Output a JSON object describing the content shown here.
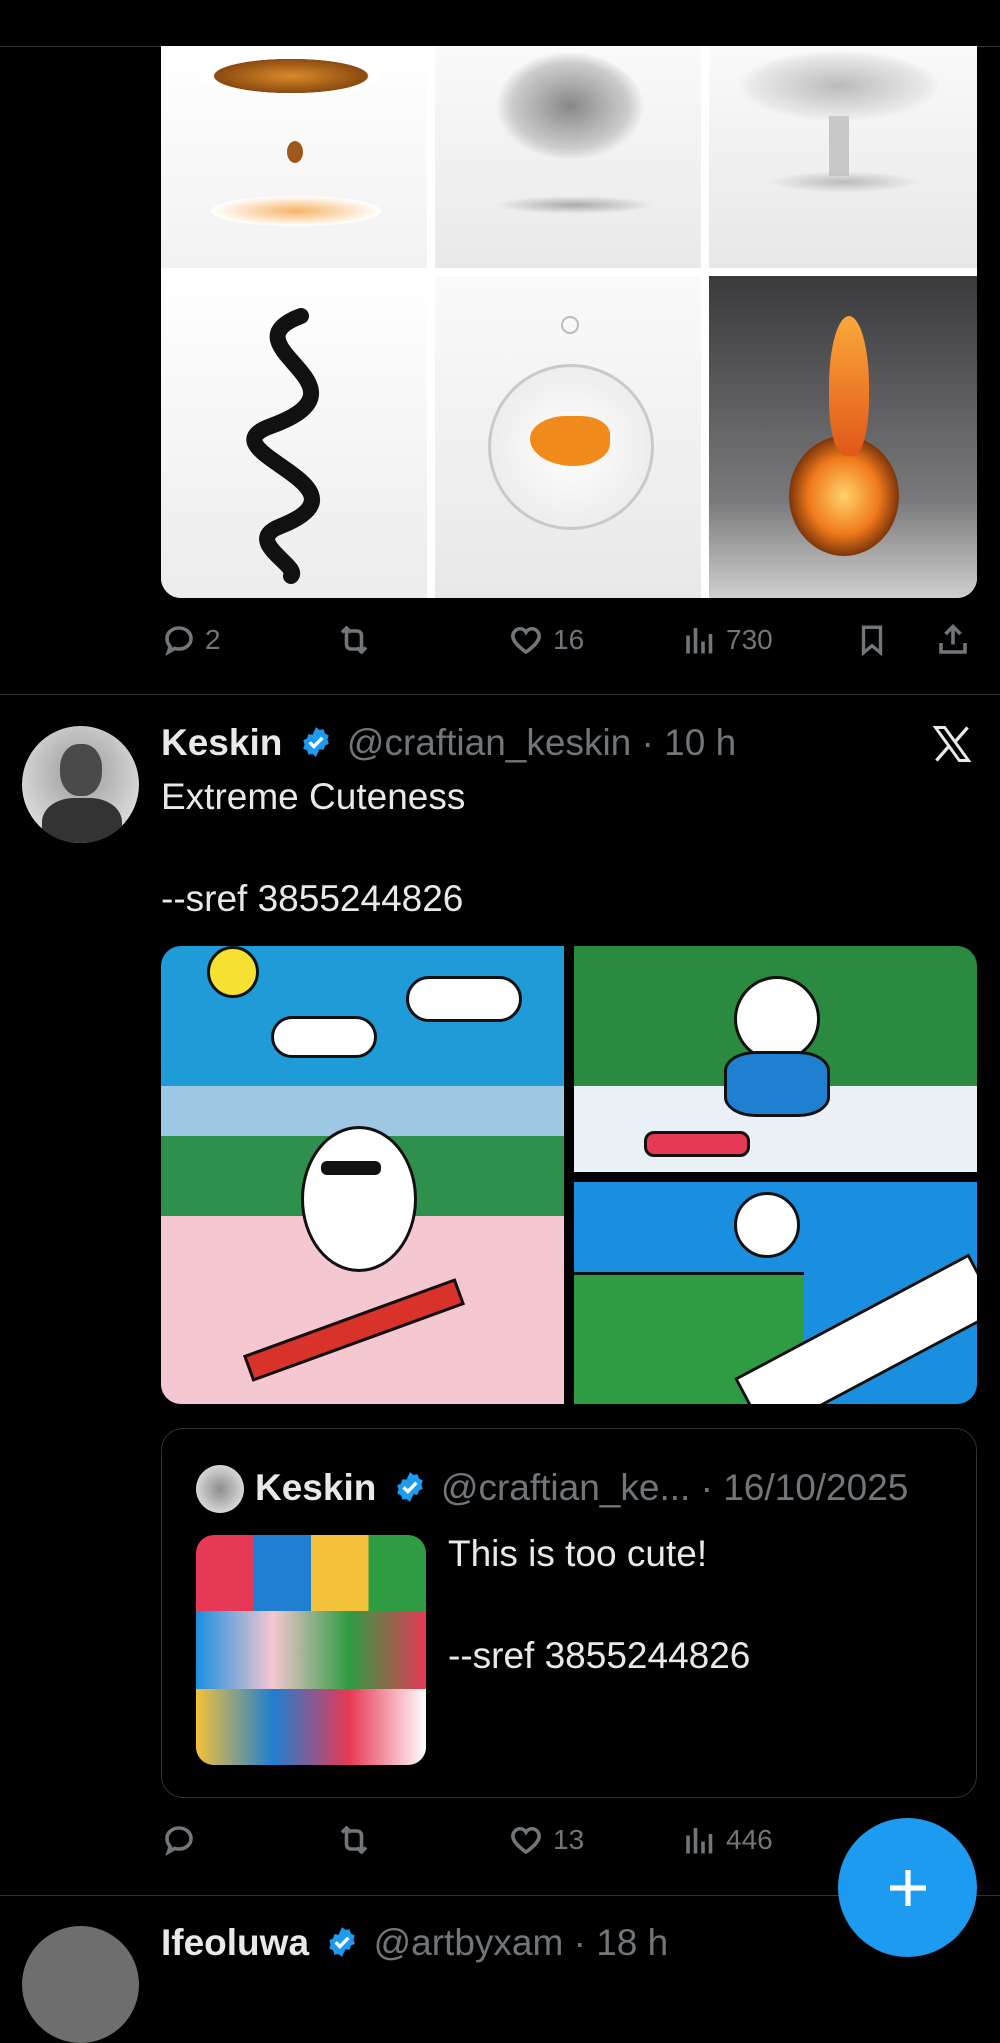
{
  "colors": {
    "accent": "#1d9bf0",
    "muted": "#71767b",
    "text": "#e7e9ea",
    "border": "#2f3336"
  },
  "post1": {
    "actions": {
      "replies": "2",
      "likes": "16",
      "views": "730"
    },
    "media_alt": [
      "amber liquid drop",
      "liquid horse splash",
      "glass lotus",
      "black liquid spiral",
      "goldfish in glass bowl",
      "flame sphere"
    ]
  },
  "post2": {
    "author_name": "Keskin",
    "handle": "@craftian_keskin",
    "time": "10 h",
    "text_line1": "Extreme Cuteness",
    "text_line2": "--sref 3855244826",
    "platform_icon": "x-logo-icon",
    "quote": {
      "author_name": "Keskin",
      "handle": "@craftian_ke...",
      "date": "16/10/2025",
      "text_line1": "This is too cute!",
      "text_line2": "--sref 3855244826"
    },
    "actions": {
      "likes": "13",
      "views": "446"
    }
  },
  "post3": {
    "author_name": "Ifeoluwa",
    "handle": "@artbyxam",
    "time": "18 h"
  },
  "fab": {
    "icon": "plus-icon",
    "label": "+"
  }
}
